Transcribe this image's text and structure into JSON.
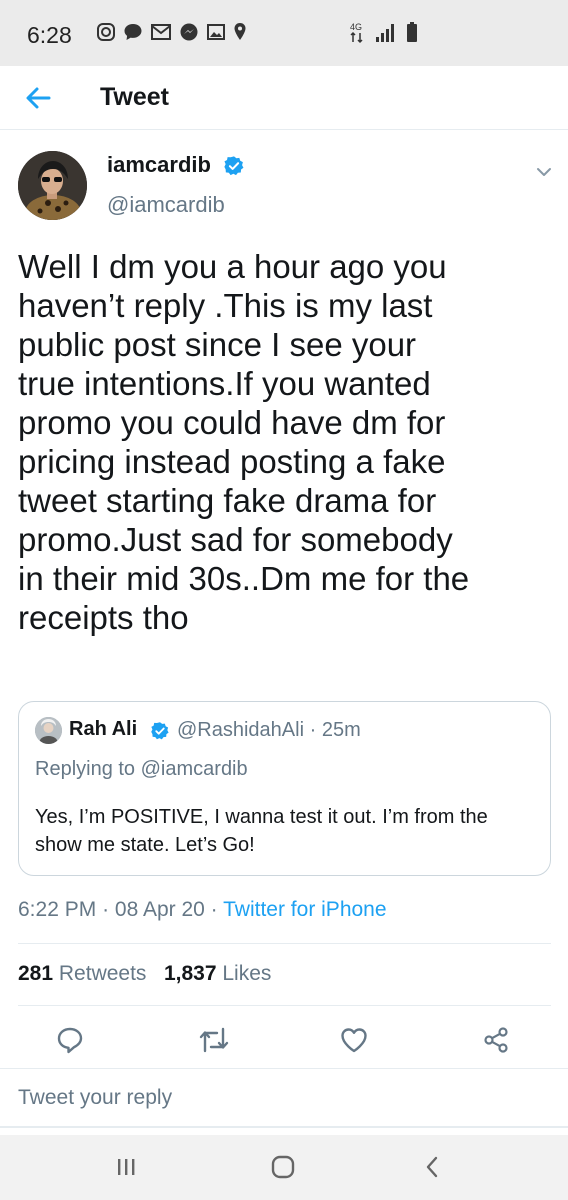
{
  "status_bar": {
    "time": "6:28",
    "left_icons": [
      "instagram-icon",
      "chat-bubble-icon",
      "gmail-icon",
      "messenger-icon",
      "gallery-icon",
      "location-icon"
    ],
    "right_icons": [
      "data-4g-icon",
      "signal-icon",
      "battery-icon"
    ]
  },
  "header": {
    "title": "Tweet",
    "back_icon": "arrow-left-icon"
  },
  "tweet": {
    "display_name": "iamcardib",
    "handle": "@iamcardib",
    "text_lines": [
      "Well I dm you a hour ago you",
      "haven’t reply .This is my last",
      "public post since I see your",
      "true intentions.If you wanted",
      "promo you could have dm for",
      "pricing instead posting a fake",
      "tweet starting fake drama for",
      "promo.Just sad for somebody",
      "in their mid 30s..Dm me for the",
      "receipts tho"
    ],
    "quoted": {
      "display_name": "Rah Ali",
      "handle": "@RashidahAli",
      "time": "25m",
      "separator": "·",
      "replying_prefix": "Replying to",
      "replying_to": "@iamcardib",
      "text": "Yes, I’m POSITIVE, I wanna test it out. I’m from the show me state. Let’s Go!"
    },
    "time": "6:22 PM",
    "date": "08 Apr 20",
    "separator": "·",
    "source": "Twitter for iPhone",
    "retweet_count": "281",
    "retweet_label": "Retweets",
    "like_count": "1,837",
    "like_label": "Likes"
  },
  "actions": [
    "reply-icon",
    "retweet-icon",
    "like-icon",
    "share-icon"
  ],
  "reply_placeholder": "Tweet your reply",
  "nav_bar": [
    "recents-icon",
    "home-icon",
    "back-icon"
  ],
  "colors": {
    "accent": "#1da1f2",
    "secondary_text": "#657786",
    "primary_text": "#14171a",
    "border": "#ccd6dd"
  }
}
